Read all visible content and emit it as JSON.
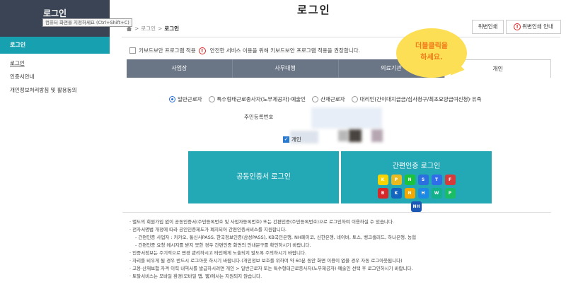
{
  "sidebar": {
    "title": "로그인",
    "tooltip": "컴퓨터 화면을 지정하세요 (Ctrl+Shift+C)",
    "active_item": "로그인",
    "items": [
      {
        "label": "로그인"
      },
      {
        "label": "인증서안내"
      },
      {
        "label": "개인정보처리방침 및 활용동의"
      }
    ]
  },
  "page": {
    "title": "로그인",
    "breadcrumb": [
      "로그인",
      "로그인"
    ],
    "top_buttons": {
      "btn1": "위변인쇄",
      "btn2": "위변인쇄 안내"
    }
  },
  "keyboard": {
    "label": "키보드보안 프로그램 적용",
    "notice": "안전한 서비스 이용을 위해 키보드보안 프로그램 적용을 권장합니다."
  },
  "tabs": [
    {
      "label": "사업장"
    },
    {
      "label": "사무대행"
    },
    {
      "label": "의료기관"
    },
    {
      "label": "개인"
    }
  ],
  "bubble": {
    "line1": "더블클릭을",
    "line2": "하세요."
  },
  "radios": [
    {
      "label": "일반근로자",
      "checked": true
    },
    {
      "label": "특수형태근로종사자(노무제공자)·예술인",
      "checked": false
    },
    {
      "label": "산재근로자",
      "checked": false
    },
    {
      "label": "대리인(간이대지급금/심사청구/최초요양급여신청)·유족",
      "checked": false
    }
  ],
  "rrn": {
    "label": "주민등록번호"
  },
  "save": {
    "label": "개인"
  },
  "login": {
    "cert_label": "공동인증서 로그인",
    "simple_label": "간편인증 로그인"
  },
  "app_icons": [
    {
      "name": "kakao",
      "color": "#f7d400",
      "text": "K"
    },
    {
      "name": "pass",
      "color": "#e8ba20",
      "text": "P"
    },
    {
      "name": "naver",
      "color": "#19c43c",
      "text": "N"
    },
    {
      "name": "shinhan",
      "color": "#2c6fde",
      "text": "S"
    },
    {
      "name": "toss",
      "color": "#2f6ee8",
      "text": "T"
    },
    {
      "name": "samsung",
      "color": "#d63b3b",
      "text": "F"
    },
    {
      "name": "bank",
      "color": "#d62828",
      "text": "B"
    },
    {
      "name": "kb",
      "color": "#1565c0",
      "text": "K"
    },
    {
      "name": "nh",
      "color": "#f2a800",
      "text": "N"
    },
    {
      "name": "hana",
      "color": "#1e88e5",
      "text": "H"
    },
    {
      "name": "woori",
      "color": "#13b08c",
      "text": "W"
    },
    {
      "name": "payco",
      "color": "#1abc64",
      "text": "P"
    },
    {
      "name": "nhpay",
      "color": "#1c58b5",
      "text": "NH"
    }
  ],
  "notice": [
    {
      "text": "별도의 회원가입 없이 공동인증서(주민등록번호 및 사업자등록번호) 또는 간편인증(주민등록번호)으로 로그인하여 이용하실 수 있습니다.",
      "sub": false
    },
    {
      "text": "전자서명법 개정에 따라 공인인증제도가 폐지되어 간편인증서비스를 지원합니다.",
      "sub": false
    },
    {
      "text": "간편인증 사업자 : 카카오, 통신사PASS, 한국정보인증(삼성PASS), KB국민은행, NH페이코, 신한은행, 네이버, 토스, 뱅크샐러드, 하나은행, 농협",
      "sub": true
    },
    {
      "text": "간편인증 요청 메시지를 받지 못한 경우 간편인증 화면의 안내문구를 확인하시기 바랍니다.",
      "sub": true
    },
    {
      "text": "인증서정보는 주기적으로 변경 관리하시고 타인에게 노출되지 않도록 주의하시기 바랍니다.",
      "sub": false
    },
    {
      "text": "자리를 비우게 될 경우 반드시 로그아웃 하시기 바랍니다.(개인정보 보호를 위하여 약 60분 동안 화면 이용이 없을 경우 자동 로그아웃됩니다)",
      "sub": false
    },
    {
      "text": "고용·산재보험 자격 이력 내역서를 발급하시려면 개인 > 일반근로자 또는 특수형태근로종사자(노무제공자)·예술인 선택 후 로그인하시기 바랍니다.",
      "sub": false
    },
    {
      "text": "토탈서비스는 모바일 환경(모바일 앱, 웹)에서는 지원되지 않습니다.",
      "sub": false
    }
  ]
}
